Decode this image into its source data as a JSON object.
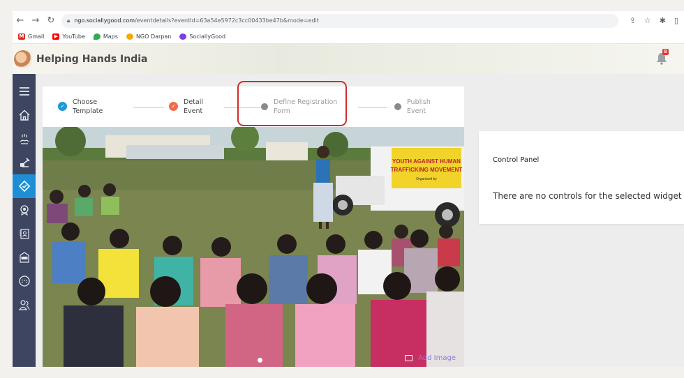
{
  "browser": {
    "url_host": "ngo.sociallygood.com",
    "url_path": "/eventdetails?eventId=63a54e5972c3cc00433be47b&mode=edit",
    "bookmarks": [
      {
        "label": "Gmail",
        "icon": "gmail-icon",
        "color": "#d93025"
      },
      {
        "label": "YouTube",
        "icon": "youtube-icon",
        "color": "#ff0000"
      },
      {
        "label": "Maps",
        "icon": "maps-icon",
        "color": "#34a853"
      },
      {
        "label": "NGO Darpan",
        "icon": "ngo-darpan-icon",
        "color": "#f2a900"
      },
      {
        "label": "SociallyGood",
        "icon": "sociallygood-icon",
        "color": "#7b3fe4"
      }
    ]
  },
  "app": {
    "title": "Helping Hands India",
    "notification_count": "8"
  },
  "sidebar": {
    "items": [
      {
        "icon": "menu-icon",
        "active": false
      },
      {
        "icon": "home-icon",
        "active": false
      },
      {
        "icon": "hands-icon",
        "active": false
      },
      {
        "icon": "campaign-icon",
        "active": false
      },
      {
        "icon": "events-icon",
        "active": true
      },
      {
        "icon": "badge-icon",
        "active": false
      },
      {
        "icon": "volunteer-icon",
        "active": false
      },
      {
        "icon": "ngo-icon",
        "active": false
      },
      {
        "icon": "csr-icon",
        "active": false
      },
      {
        "icon": "people-icon",
        "active": false
      }
    ]
  },
  "stepper": {
    "steps": [
      {
        "line1": "Choose",
        "line2": "Template",
        "state": "done"
      },
      {
        "line1": "Detail",
        "line2": "Event",
        "state": "done"
      },
      {
        "line1": "Define Registration",
        "line2": "Form",
        "state": "pending"
      },
      {
        "line1": "Publish",
        "line2": "Event",
        "state": "pending"
      }
    ]
  },
  "banner": {
    "sign_line1": "YOUTH AGAINST HUMAN",
    "sign_line2": "TRAFFICKING MOVEMENT",
    "sign_line3": "Organised by",
    "add_image_label": "Add Image"
  },
  "control_panel": {
    "title": "Control Panel",
    "message": "There are no controls for the selected widget"
  },
  "colors": {
    "sidebar_bg": "#3d4560",
    "active_item": "#1e8fd6",
    "step_done_blue": "#1a9ad6",
    "step_done_orange": "#f06b4a",
    "highlight": "#d22a2a"
  }
}
